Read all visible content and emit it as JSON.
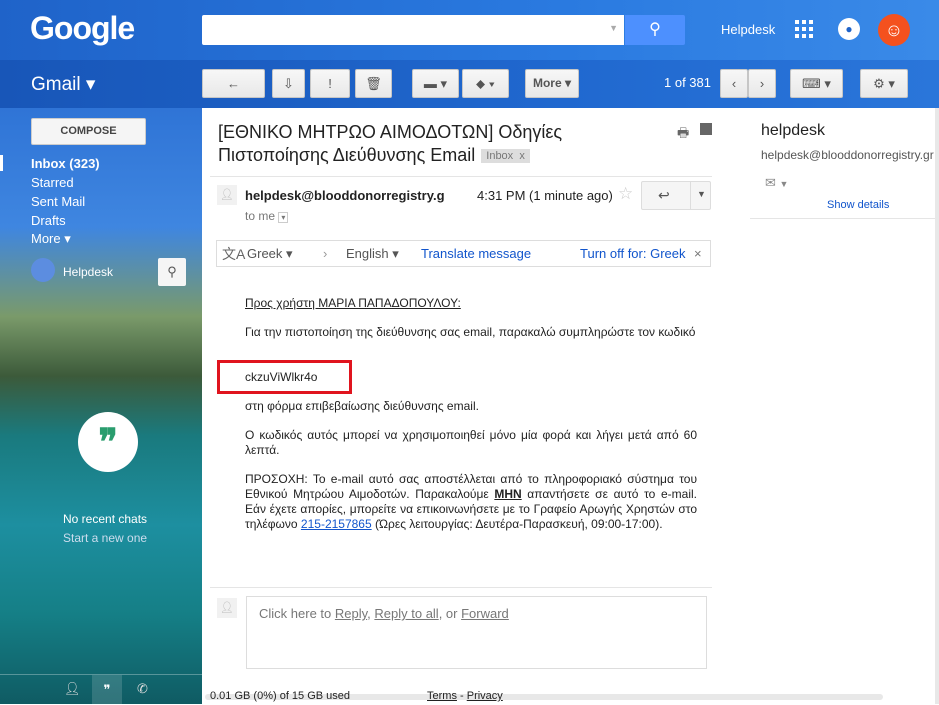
{
  "header": {
    "logo": "Google",
    "search_placeholder": "",
    "account_name": "Helpdesk",
    "avatar_initial": "☺"
  },
  "toolbar": {
    "app_name": "Gmail ▾",
    "back": "←",
    "archive": "⇩",
    "spam": "!",
    "delete": "🗑",
    "move": "▬ ▾",
    "labels": "⬥ ▾",
    "more": "More ▾",
    "pager": "1 of 381",
    "prev": "‹",
    "next": "›",
    "keyboard": "⌨ ▾",
    "settings": "⚙ ▾"
  },
  "sidebar": {
    "compose": "COMPOSE",
    "items": [
      {
        "label": "Inbox (323)",
        "bold": true
      },
      {
        "label": "Starred"
      },
      {
        "label": "Sent Mail"
      },
      {
        "label": "Drafts"
      },
      {
        "label": "More ▾"
      }
    ],
    "chat_user": "Helpdesk",
    "no_chats": "No recent chats",
    "start_chat": "Start a new one"
  },
  "email": {
    "subject": "[ΕΘΝΙΚΟ ΜΗΤΡΩΟ ΑΙΜΟΔΟΤΩΝ] Οδηγίες Πιστοποίησης Διεύθυνσης Email",
    "label": "Inbox",
    "label_close": "x",
    "sender": "helpdesk@blooddonorregistry.g",
    "to": "to me",
    "time": "4:31 PM (1 minute ago)",
    "translate": {
      "from": "Greek ▾",
      "arrow": "›",
      "to": "English ▾",
      "action": "Translate message",
      "turn_off": "Turn off for: Greek",
      "close": "×"
    },
    "greeting": "Προς χρήστη ΜΑΡΙΑ ΠΑΠΑΔΟΠΟΥΛΟΥ:",
    "p1": "Για την πιστοποίηση της διεύθυνσης σας email, παρακαλώ συμπληρώστε τον κωδικό",
    "code": "ckzuViWlkr4o",
    "p2": "στη φόρμα επιβεβαίωσης διεύθυνσης email.",
    "p3": "Ο κωδικός αυτός μπορεί να χρησιμοποιηθεί μόνο μία φορά και λήγει μετά από 60 λεπτά.",
    "p4a": "ΠΡΟΣΟΧΗ: Το e-mail αυτό σας αποστέλλεται από το πληροφοριακό σύστημα του Εθνικού Μητρώου Αιμοδοτών. Παρακαλούμε ",
    "p4_bold": "ΜΗΝ",
    "p4b": " απαντήσετε σε αυτό το e-mail. Εάν έχετε απορίες, μπορείτε να επικοινωνήσετε με το Γραφείο Αρωγής Χρηστών στο τηλέφωνο ",
    "phone": "215-2157865",
    "p4c": " (Ώρες λειτουργίας: Δευτέρα-Παρασκευή, 09:00-17:00).",
    "reply_prefix": "Click here to ",
    "reply": "Reply",
    "sep1": ", ",
    "reply_all": "Reply to all",
    "sep2": ", or ",
    "forward": "Forward"
  },
  "footer": {
    "storage": "0.01 GB (0%) of 15 GB used",
    "terms": "Terms",
    "dash": " - ",
    "privacy": "Privacy"
  },
  "contact": {
    "name": "helpdesk",
    "email": "helpdesk@blooddonorregistry.gr",
    "show_details": "Show details"
  }
}
